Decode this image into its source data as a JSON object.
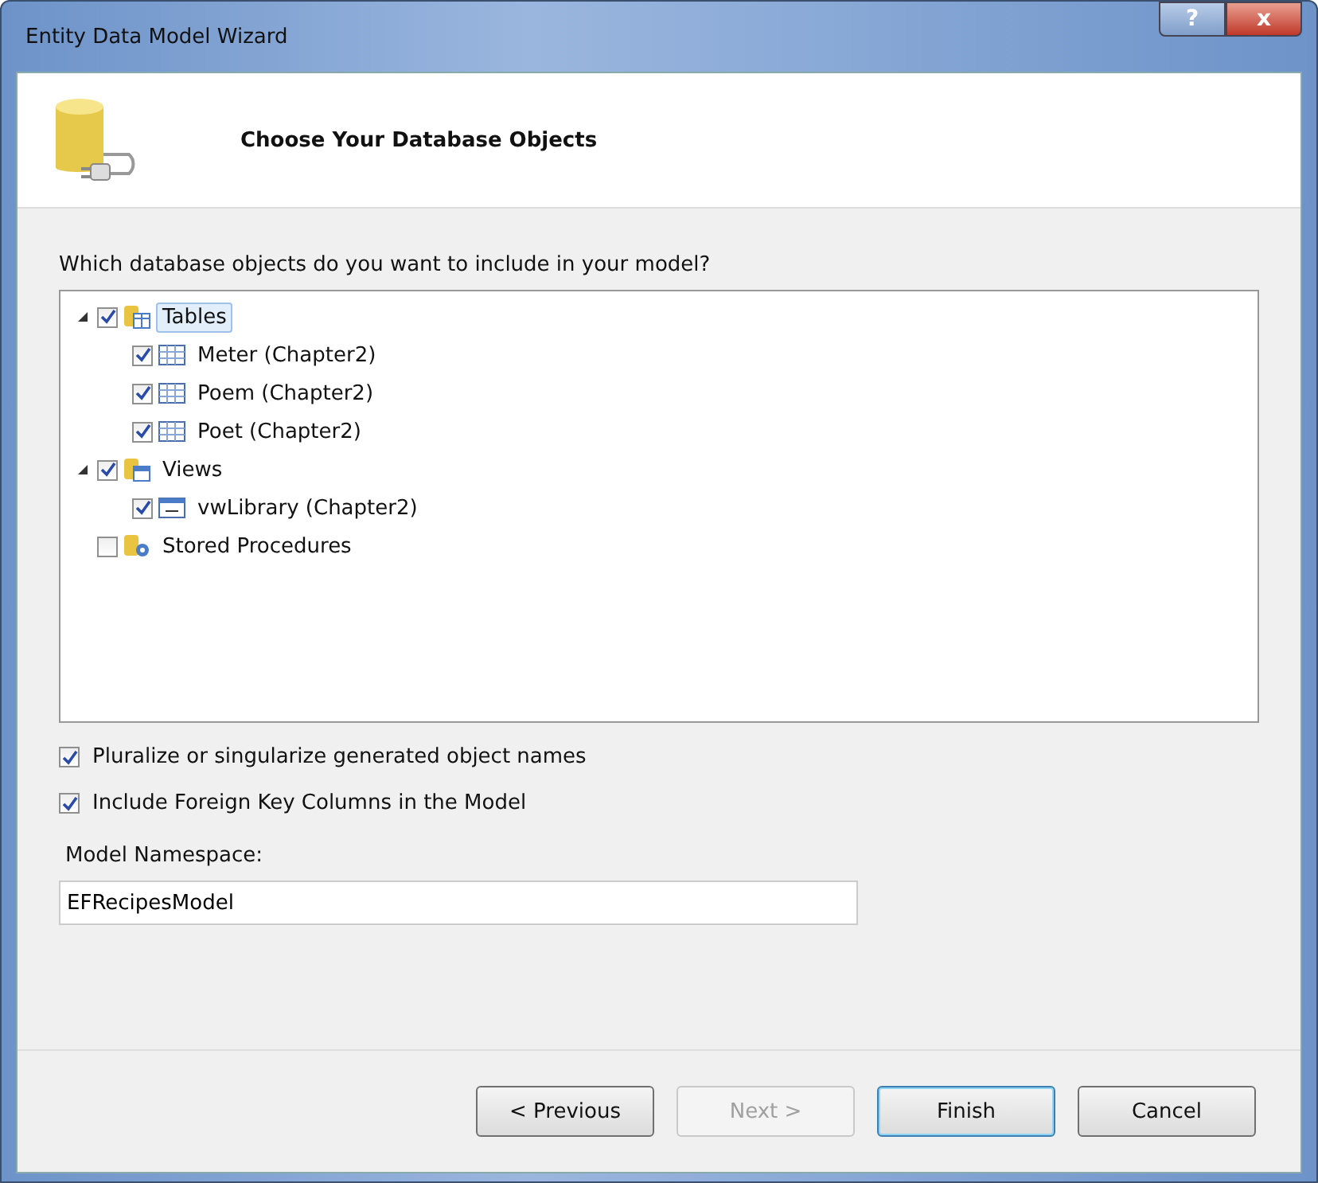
{
  "window": {
    "title": "Entity Data Model Wizard",
    "buttons": [
      "?",
      "x"
    ]
  },
  "header": {
    "title": "Choose Your Database Objects"
  },
  "prompt": "Which database objects do you want to include in your model?",
  "tree": [
    {
      "label": "Tables",
      "kind": "tables",
      "checked": true,
      "expanded": true,
      "selected": true,
      "children": [
        {
          "label": "Meter (Chapter2)",
          "kind": "table",
          "checked": true,
          "selected": false
        },
        {
          "label": "Poem (Chapter2)",
          "kind": "table",
          "checked": true,
          "selected": false
        },
        {
          "label": "Poet (Chapter2)",
          "kind": "table",
          "checked": true,
          "selected": false
        }
      ]
    },
    {
      "label": "Views",
      "kind": "views",
      "checked": true,
      "expanded": true,
      "selected": false,
      "children": [
        {
          "label": "vwLibrary (Chapter2)",
          "kind": "view",
          "checked": true,
          "selected": false
        }
      ]
    },
    {
      "label": "Stored Procedures",
      "kind": "procedures",
      "checked": false,
      "selected": false
    }
  ],
  "options": [
    {
      "label": "Pluralize or singularize generated object names",
      "checked": true
    },
    {
      "label": "Include Foreign Key Columns in the Model",
      "checked": true
    }
  ],
  "namespace": {
    "label": "Model Namespace:",
    "value": "EFRecipesModel"
  },
  "buttons": [
    {
      "label": "< Previous",
      "disabled": false,
      "default": false
    },
    {
      "label": "Next >",
      "disabled": true,
      "default": false
    },
    {
      "label": "Finish",
      "disabled": false,
      "default": true
    },
    {
      "label": "Cancel",
      "disabled": false,
      "default": false
    }
  ]
}
